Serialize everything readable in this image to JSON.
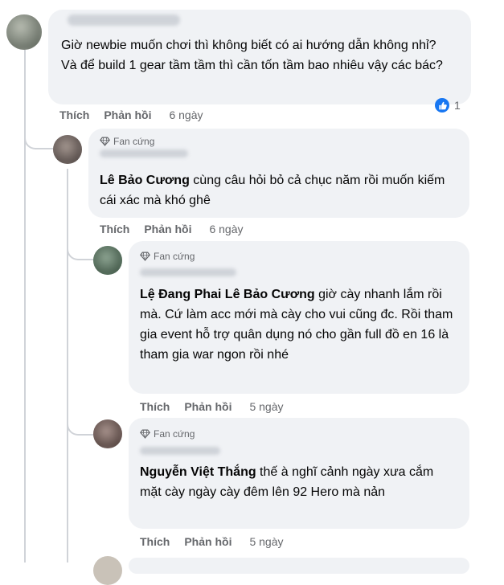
{
  "labels": {
    "like": "Thích",
    "reply": "Phản hồi",
    "fan_badge": "Fan cứng"
  },
  "icons": {
    "badge": "diamond-icon",
    "reaction": "like-icon"
  },
  "colors": {
    "bubble_bg": "#f0f2f5",
    "meta_text": "#65676b",
    "like_blue": "#1877f2"
  },
  "comments": [
    {
      "text": "Giờ newbie muốn chơi thì không biết có ai hướng dẫn không nhỉ? Và để build 1 gear tầm tầm thì cần tốn tầm bao nhiêu vậy các bác?",
      "time": "6 ngày",
      "reaction_count": "1"
    },
    {
      "mention": "Lê Bảo Cương",
      "text": " cùng câu hỏi bỏ cả chục năm rồi muốn kiếm cái xác mà khó ghê",
      "time": "6 ngày"
    },
    {
      "mention": "Lệ Đang Phai Lê Bảo Cương",
      "text": " giờ cày nhanh lắm rồi mà. Cứ làm acc mới mà cày cho vui cũng đc. Rồi tham gia event hỗ trợ quân dụng nó cho gần full đồ en 16 là tham gia war ngon rồi nhé",
      "time": "5 ngày"
    },
    {
      "mention": "Nguyễn Việt Thắng",
      "text": " thế à nghĩ cảnh ngày xưa cắm mặt cày ngày cày đêm lên 92 Hero mà nản",
      "time": "5 ngày"
    }
  ]
}
